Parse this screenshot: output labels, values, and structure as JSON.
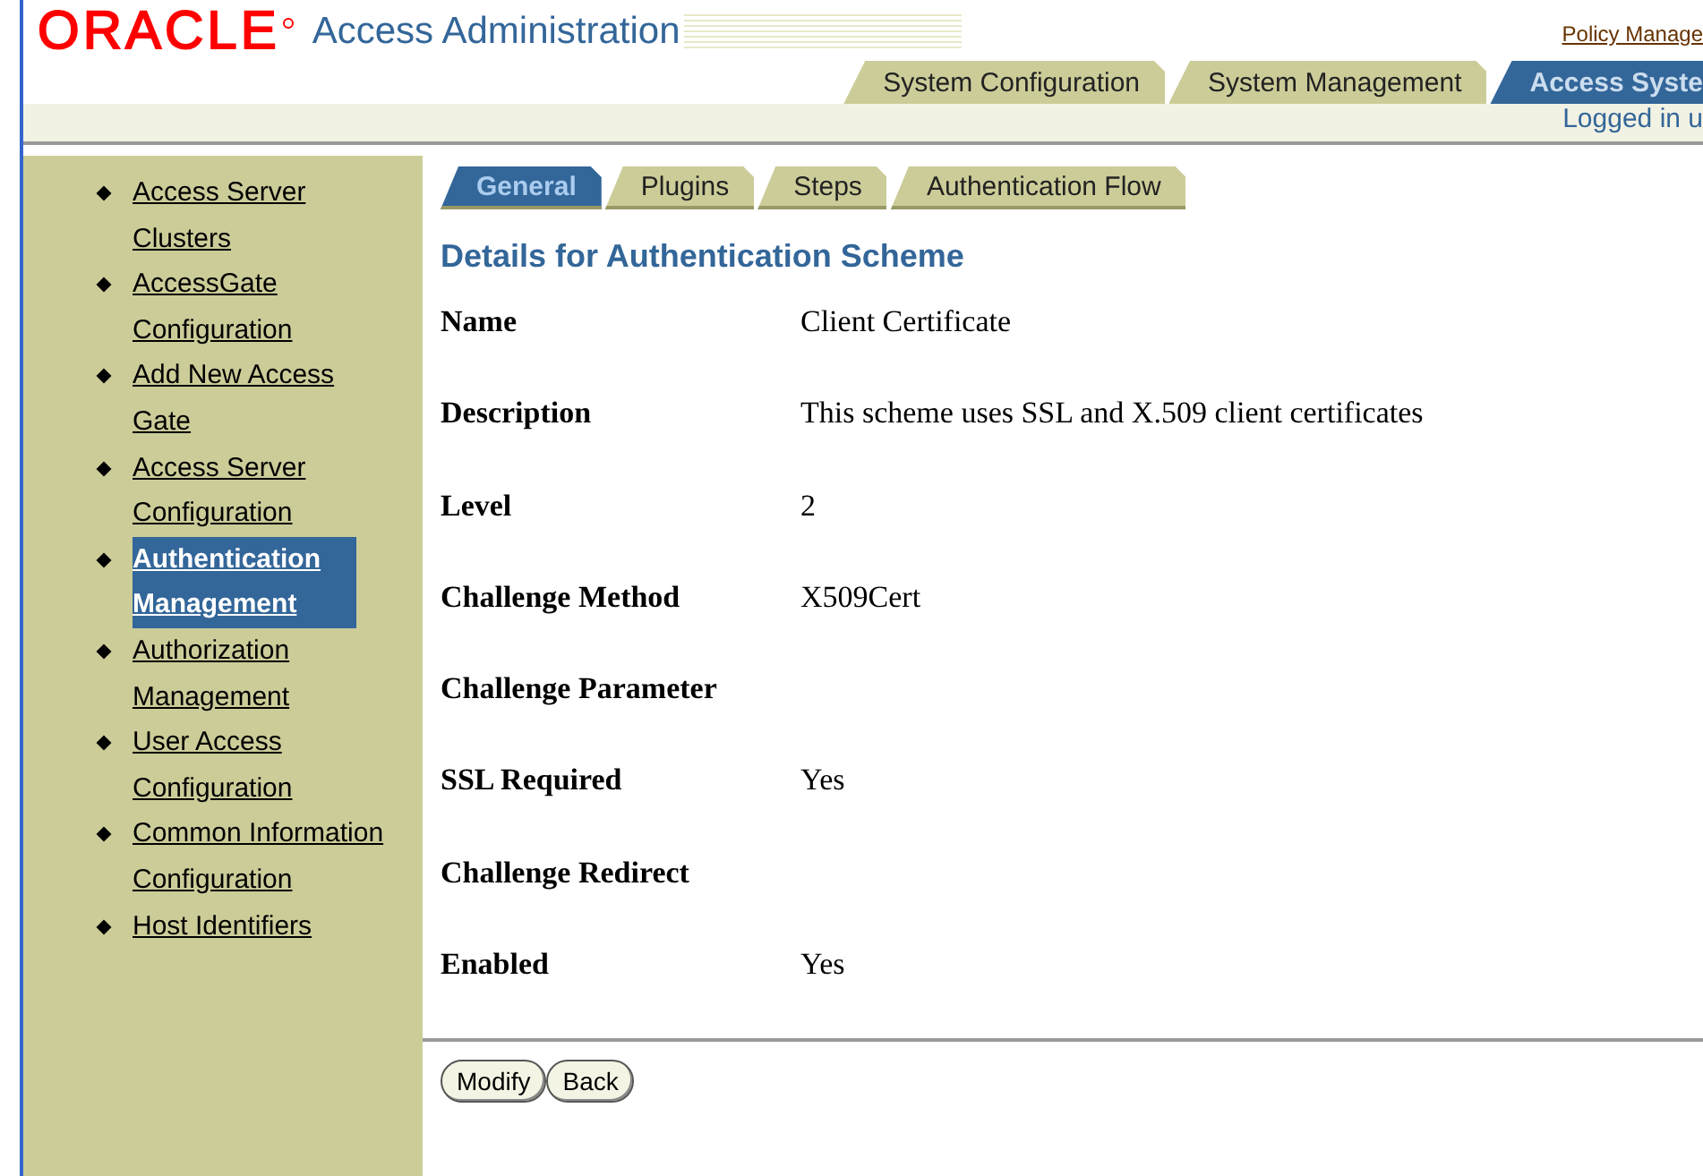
{
  "header": {
    "logo": "ORACLE",
    "product": "Access Administration",
    "policy_link": "Policy Manage",
    "tabs": [
      {
        "label": "System Configuration",
        "selected": false
      },
      {
        "label": "System Management",
        "selected": false
      },
      {
        "label": "Access Syste",
        "selected": true
      }
    ],
    "logged_in": "Logged in u"
  },
  "sidebar": {
    "items": [
      {
        "label": "Access Server Clusters",
        "selected": false
      },
      {
        "label": "AccessGate Configuration",
        "selected": false
      },
      {
        "label": "Add New Access Gate",
        "selected": false
      },
      {
        "label": "Access Server Configuration",
        "selected": false
      },
      {
        "label": "Authentication Management",
        "selected": true
      },
      {
        "label": "Authorization Management",
        "selected": false
      },
      {
        "label": "User Access Configuration",
        "selected": false
      },
      {
        "label": "Common Information Configuration",
        "selected": false
      },
      {
        "label": "Host Identifiers",
        "selected": false
      }
    ]
  },
  "content": {
    "tabs": [
      {
        "label": "General",
        "selected": true
      },
      {
        "label": "Plugins",
        "selected": false
      },
      {
        "label": "Steps",
        "selected": false
      },
      {
        "label": "Authentication Flow",
        "selected": false
      }
    ],
    "heading": "Details for Authentication Scheme",
    "fields": [
      {
        "label": "Name",
        "value": "Client Certificate"
      },
      {
        "label": "Description",
        "value": "This scheme uses SSL and X.509 client certificates"
      },
      {
        "label": "Level",
        "value": "2"
      },
      {
        "label": "Challenge Method",
        "value": "X509Cert"
      },
      {
        "label": "Challenge Parameter"
      },
      {
        "label": "SSL Required",
        "value": "Yes"
      },
      {
        "label": "Challenge Redirect"
      },
      {
        "label": "Enabled",
        "value": "Yes"
      }
    ],
    "buttons": [
      "Modify",
      "Back"
    ]
  }
}
